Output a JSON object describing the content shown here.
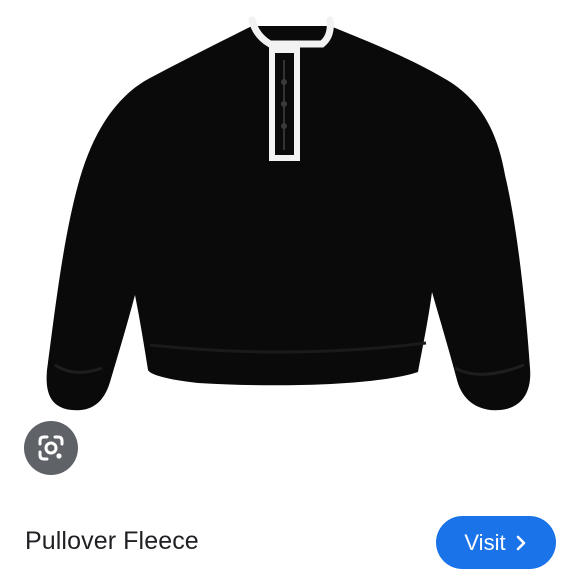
{
  "product": {
    "title": "Pullover Fleece",
    "image_icon": "sweater-image"
  },
  "lens": {
    "icon": "lens-icon"
  },
  "visit_button": {
    "label": "Visit",
    "icon": "chevron-right-icon"
  },
  "colors": {
    "accent": "#1a73e8",
    "lens_bg": "#5f6368",
    "garment": "#0a0a0a",
    "trim": "#f2f2f2"
  }
}
